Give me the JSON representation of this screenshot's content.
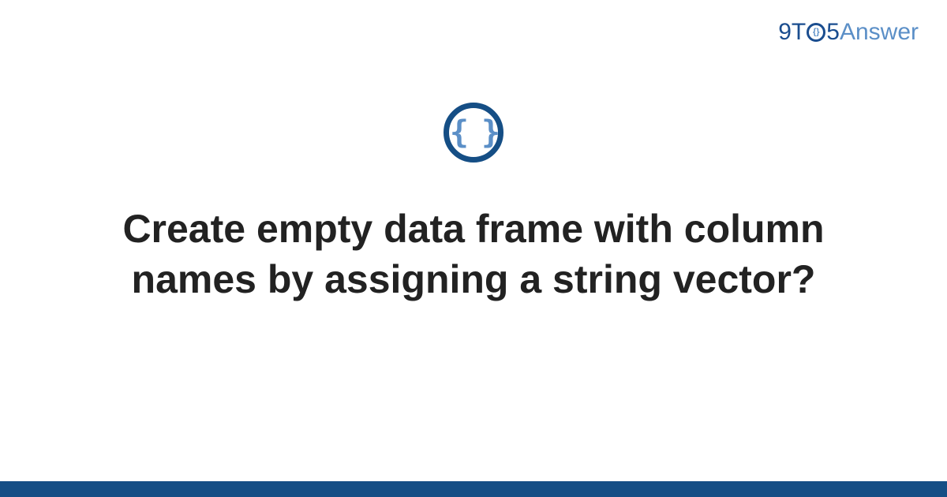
{
  "logo": {
    "part1": "9T",
    "circle_inner": "{}",
    "part2": "5",
    "part3": "Answer"
  },
  "icon": {
    "braces": "{ }"
  },
  "title": "Create empty data frame with column names by assigning a string vector?"
}
